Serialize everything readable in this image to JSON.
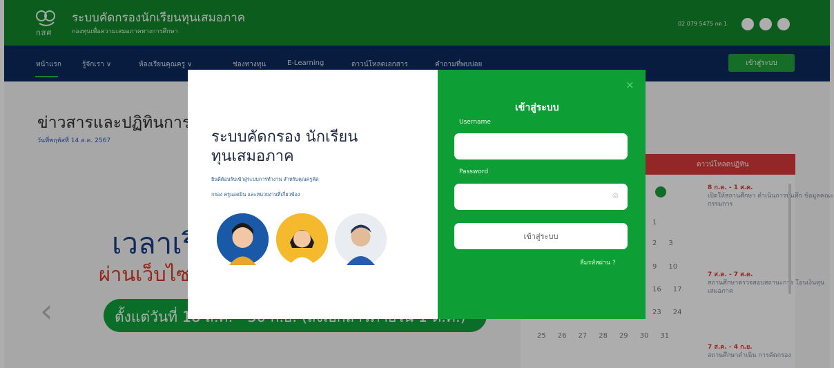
{
  "header": {
    "logo_label": "กสศ",
    "title": "ระบบคัดกรองนักเรียนทุนเสมอภาค",
    "subtitle": "กองทุนเพื่อความเสมอภาคทางการศึกษา",
    "phone": "02 079 5475 กด 1",
    "icons": [
      "phone-icon",
      "line-icon",
      "facebook-icon"
    ],
    "brand_color": "#128a2c"
  },
  "nav": {
    "items": [
      {
        "label": "หน้าแรก"
      },
      {
        "label": "รู้จักเรา ∨"
      },
      {
        "label": "ห้องเรียนคุณครู ∨"
      },
      {
        "label": "ช่องทางทุน"
      },
      {
        "label": "E-Learning"
      },
      {
        "label": "ดาวน์โหลดเอกสาร"
      },
      {
        "label": "คำถามที่พบบ่อย"
      }
    ],
    "login_button": "เข้าสู่ระบบ"
  },
  "main": {
    "news_title": "ข่าวสารและปฏิทินการ",
    "news_date": "วันที่พฤหัสที่ 14 ส.ค. 2567",
    "hero_line_1": "เวลาเริ่",
    "hero_line_2": "ผ่านเว็บไซ",
    "hero_bar_text": "ตั้งแต่วันที่ 18 ส.ค. - 30 ก.ย. (ส่งเอกสารภายใน 1 ต.ค.)",
    "activity_tab": "ดาวน์โหลดปฏิทิน",
    "calendar_rows": [
      [
        "",
        "",
        "",
        "",
        "",
        "",
        "1"
      ],
      [
        "",
        "",
        "",
        "",
        "",
        "",
        "2"
      ],
      [
        "",
        "",
        "",
        "",
        "",
        "2",
        "3"
      ],
      [
        "",
        "",
        "",
        "",
        "",
        "9",
        "10"
      ],
      [
        "",
        "",
        "",
        "",
        "",
        "16",
        "17"
      ],
      [
        "",
        "",
        "",
        "",
        "",
        "23",
        "24"
      ],
      [
        "25",
        "26",
        "27",
        "28",
        "29",
        "30",
        "31"
      ]
    ],
    "events": [
      {
        "head": "8 ก.ค. - 1 ส.ค.",
        "body": "เปิดให้สถานศึกษา ดำเนินการบันทึก ข้อมูลคณะกรรมการ"
      },
      {
        "head": "7 ส.ค. - 7 ส.ค.",
        "body": "สถานศึกษาตรวจสอบสถานะการ โอนเงินทุนเสมอภาค"
      },
      {
        "head": "7 ส.ค. - 4 ก.ย.",
        "body": "สถานศึกษาดำเนิน การคัดกรอง"
      }
    ]
  },
  "modal": {
    "left_title_1": "ระบบคัดกรอง นักเรียน",
    "left_title_2": "ทุนเสมอภาค",
    "left_desc_1": "ยินดีต้อนรับเข้าสู่ระบบการทำงาน สำหรับคุณครูคัด",
    "left_desc_2": "กรอง ครูแอดมิน และหน่วยงานที่เกี่ยวข้อง",
    "right_title": "เข้าสู่ระบบ",
    "username_label": "Username",
    "password_label": "Password",
    "submit_label": "เข้าสู่ระบบ",
    "forgot_label": "ลืมรหัสผ่าน ?",
    "close_label": "×",
    "right_bg": "#0d9e36"
  }
}
